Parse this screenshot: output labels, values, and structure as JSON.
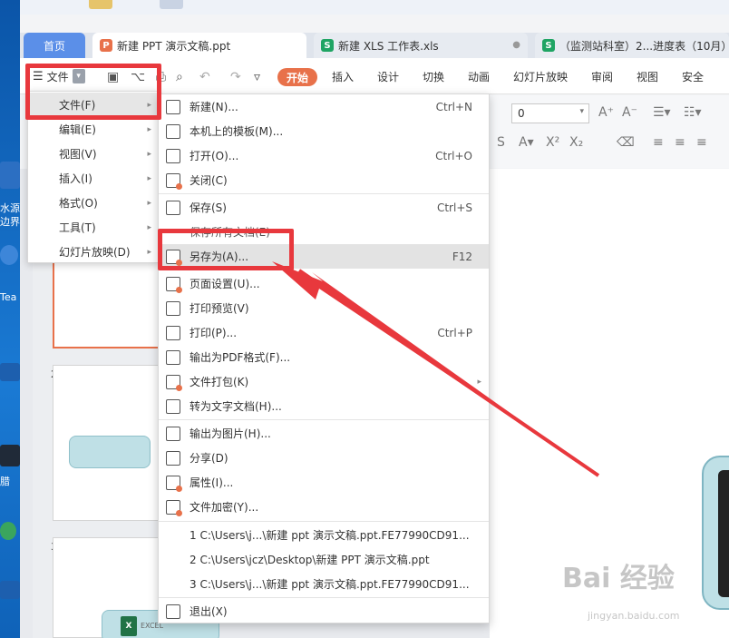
{
  "app_tabs": {
    "home": "首页",
    "docs": [
      {
        "label": "新建 PPT 演示文稿.ppt",
        "type": "P",
        "color": "#e8714a",
        "active": true
      },
      {
        "label": "新建 XLS 工作表.xls",
        "type": "S",
        "color": "#1fa463",
        "active": false
      },
      {
        "label": "（监测站科室）2...进度表（10月）",
        "type": "S",
        "color": "#1fa463",
        "active": false
      }
    ]
  },
  "menubar": {
    "file": "文件",
    "tabs": [
      "开始",
      "插入",
      "设计",
      "切换",
      "动画",
      "幻灯片放映",
      "审阅",
      "视图",
      "安全"
    ]
  },
  "toolbar": {
    "font_size": "0"
  },
  "left_menu": [
    {
      "label": "文件(F)",
      "highlight": true
    },
    {
      "label": "编辑(E)",
      "highlight": false
    },
    {
      "label": "视图(V)",
      "highlight": false
    },
    {
      "label": "插入(I)",
      "highlight": false
    },
    {
      "label": "格式(O)",
      "highlight": false
    },
    {
      "label": "工具(T)",
      "highlight": false
    },
    {
      "label": "幻灯片放映(D)",
      "highlight": false
    }
  ],
  "file_menu": {
    "new": {
      "label": "新建(N)...",
      "key": "Ctrl+N"
    },
    "template": {
      "label": "本机上的模板(M)..."
    },
    "open": {
      "label": "打开(O)...",
      "key": "Ctrl+O"
    },
    "close": {
      "label": "关闭(C)"
    },
    "save": {
      "label": "保存(S)",
      "key": "Ctrl+S"
    },
    "save_all": {
      "label": "保存所有文档(E)"
    },
    "save_as": {
      "label": "另存为(A)...",
      "key": "F12"
    },
    "page_setup": {
      "label": "页面设置(U)..."
    },
    "print_preview": {
      "label": "打印预览(V)"
    },
    "print": {
      "label": "打印(P)...",
      "key": "Ctrl+P"
    },
    "export_pdf": {
      "label": "输出为PDF格式(F)..."
    },
    "package": {
      "label": "文件打包(K)"
    },
    "to_text": {
      "label": "转为文字文档(H)..."
    },
    "export_image": {
      "label": "输出为图片(H)..."
    },
    "share": {
      "label": "分享(D)"
    },
    "properties": {
      "label": "属性(I)..."
    },
    "encrypt": {
      "label": "文件加密(Y)..."
    },
    "recent": [
      "1 C:\\Users\\j...\\新建 ppt 演示文稿.ppt.FE77990CD91...",
      "2 C:\\Users\\jcz\\Desktop\\新建 PPT 演示文稿.ppt",
      "3 C:\\Users\\j...\\新建 ppt 演示文稿.ppt.FE77990CD91..."
    ],
    "exit": {
      "label": "退出(X)"
    }
  },
  "thumbs": {
    "nums": [
      "2",
      "3"
    ],
    "excel_mini": "X",
    "excel_text": "EXCEL"
  },
  "desktop": {
    "labels": [
      "水源",
      "边界",
      "Tea",
      "腊"
    ]
  },
  "watermark": {
    "main": "Bai 经验",
    "sub": "jingyan.baidu.com"
  },
  "colors": {
    "accent": "#e8714a",
    "annotation": "#e8383d",
    "home_tab": "#5b8fe8"
  }
}
